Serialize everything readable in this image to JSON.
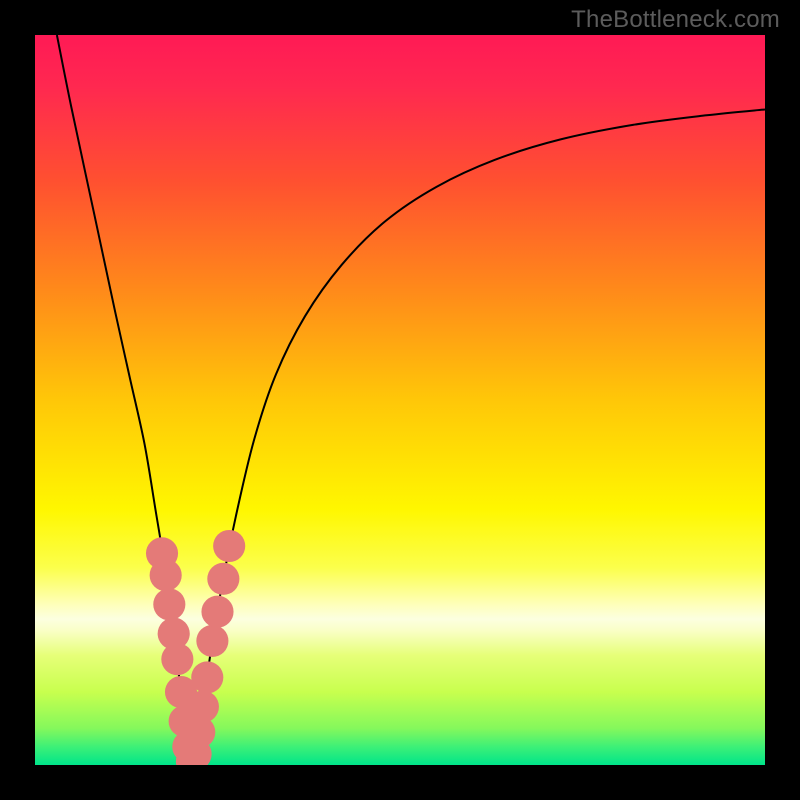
{
  "watermark": "TheBottleneck.com",
  "chart_data": {
    "type": "line",
    "title": "",
    "xlabel": "",
    "ylabel": "",
    "xlim": [
      0,
      100
    ],
    "ylim": [
      0,
      100
    ],
    "grid": false,
    "legend": null,
    "gradient_stops": [
      {
        "offset": 0.0,
        "color": "#ff1a55"
      },
      {
        "offset": 0.07,
        "color": "#ff2850"
      },
      {
        "offset": 0.2,
        "color": "#ff5030"
      },
      {
        "offset": 0.35,
        "color": "#ff8a1a"
      },
      {
        "offset": 0.5,
        "color": "#ffc708"
      },
      {
        "offset": 0.65,
        "color": "#fff700"
      },
      {
        "offset": 0.73,
        "color": "#fbff4c"
      },
      {
        "offset": 0.78,
        "color": "#feffba"
      },
      {
        "offset": 0.8,
        "color": "#fcffe0"
      },
      {
        "offset": 0.815,
        "color": "#faffc8"
      },
      {
        "offset": 0.85,
        "color": "#e6ff78"
      },
      {
        "offset": 0.9,
        "color": "#c8ff4e"
      },
      {
        "offset": 0.95,
        "color": "#84f85c"
      },
      {
        "offset": 0.975,
        "color": "#3df077"
      },
      {
        "offset": 1.0,
        "color": "#00e58a"
      }
    ],
    "series": [
      {
        "name": "bottleneck-curve",
        "color": "#000000",
        "x": [
          3,
          5,
          8,
          11,
          13,
          15,
          16.5,
          17.8,
          19,
          20,
          20.8,
          21.5,
          22.2,
          23,
          24,
          25.5,
          27.5,
          30,
          33,
          37,
          42,
          48,
          55,
          63,
          72,
          82,
          92,
          100
        ],
        "y": [
          100,
          90,
          76,
          62,
          53,
          44,
          35,
          27,
          18,
          10,
          4,
          0.5,
          3,
          8,
          15,
          24,
          34,
          44.5,
          53.5,
          61.5,
          68.5,
          74.5,
          79.2,
          82.9,
          85.7,
          87.7,
          89.0,
          89.8
        ]
      }
    ],
    "markers": {
      "name": "highlight-points",
      "color": "#e47a78",
      "radius": 2.2,
      "points": [
        {
          "x": 17.4,
          "y": 29
        },
        {
          "x": 17.9,
          "y": 26
        },
        {
          "x": 18.4,
          "y": 22
        },
        {
          "x": 19.0,
          "y": 18
        },
        {
          "x": 19.5,
          "y": 14.5
        },
        {
          "x": 20.0,
          "y": 10
        },
        {
          "x": 20.5,
          "y": 6
        },
        {
          "x": 21.0,
          "y": 2.5
        },
        {
          "x": 21.5,
          "y": 0.5
        },
        {
          "x": 22.0,
          "y": 1.5
        },
        {
          "x": 22.5,
          "y": 4.5
        },
        {
          "x": 23.0,
          "y": 8
        },
        {
          "x": 23.6,
          "y": 12
        },
        {
          "x": 24.3,
          "y": 17
        },
        {
          "x": 25.0,
          "y": 21
        },
        {
          "x": 25.8,
          "y": 25.5
        },
        {
          "x": 26.6,
          "y": 30
        }
      ]
    }
  }
}
